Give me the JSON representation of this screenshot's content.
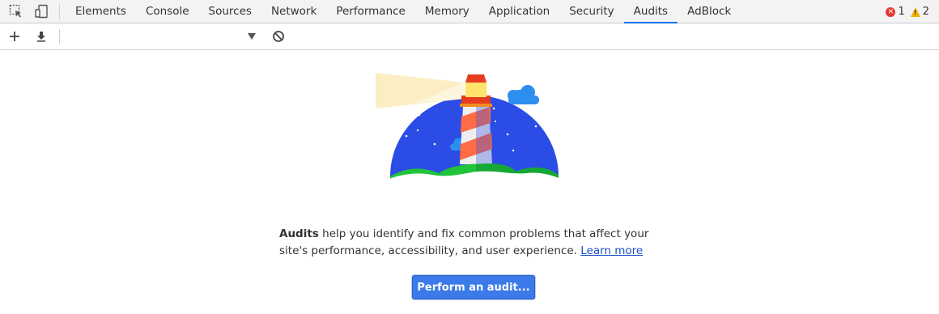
{
  "tabbar": {
    "inspect_icon": "inspect-element-icon",
    "device_icon": "device-toolbar-icon",
    "tabs": [
      {
        "label": "Elements"
      },
      {
        "label": "Console"
      },
      {
        "label": "Sources"
      },
      {
        "label": "Network"
      },
      {
        "label": "Performance"
      },
      {
        "label": "Memory"
      },
      {
        "label": "Application"
      },
      {
        "label": "Security"
      },
      {
        "label": "Audits",
        "active": true
      },
      {
        "label": "AdBlock"
      }
    ],
    "error_count": "1",
    "warning_count": "2"
  },
  "toolbar": {
    "add_icon": "plus-icon",
    "download_icon": "download-icon",
    "select_value": "",
    "clear_icon": "clear-icon"
  },
  "main": {
    "illustration": "lighthouse-logo",
    "description_bold": "Audits",
    "description_text": " help you identify and fix common problems that affect your site's performance, accessibility, and user experience. ",
    "learn_more_label": "Learn more",
    "perform_button_label": "Perform an audit..."
  },
  "colors": {
    "accent": "#1a73e8",
    "button": "#3b7ae8",
    "link": "#1a4fc4",
    "sky": "#2b4ce5",
    "grass": "#1fc43b"
  }
}
